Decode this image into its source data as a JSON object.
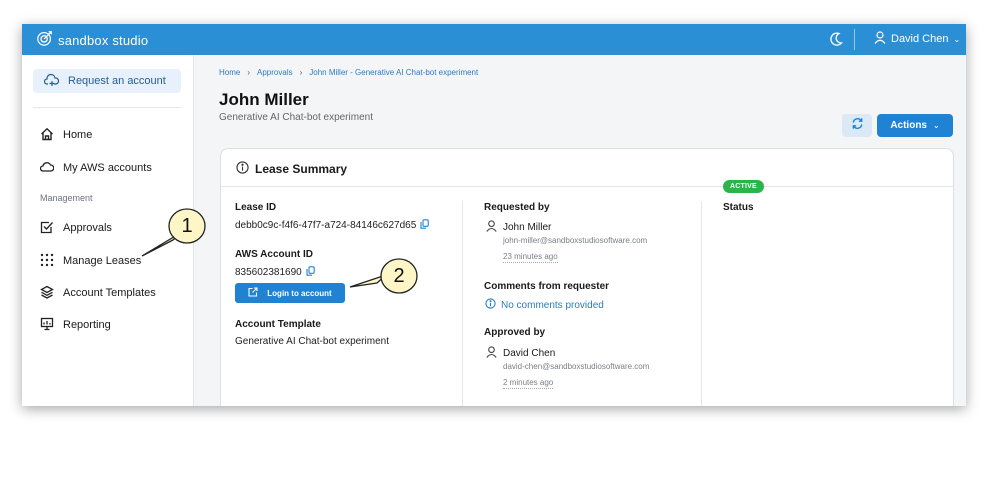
{
  "app": {
    "logo_text": "sandbox studio",
    "user_name": "David Chen",
    "accent_color": "#2b8fd6"
  },
  "sidebar": {
    "request_button": "Request an account",
    "items": [
      {
        "label": "Home",
        "icon": "home-icon"
      },
      {
        "label": "My AWS accounts",
        "icon": "cloud-icon"
      }
    ],
    "section_label": "Management",
    "management_items": [
      {
        "label": "Approvals",
        "icon": "checkbox-icon"
      },
      {
        "label": "Manage Leases",
        "icon": "grid-dots-icon"
      },
      {
        "label": "Account Templates",
        "icon": "layers-icon"
      },
      {
        "label": "Reporting",
        "icon": "presentation-chart-icon"
      }
    ]
  },
  "breadcrumb": [
    "Home",
    "Approvals",
    "John Miller - Generative AI Chat-bot experiment"
  ],
  "page": {
    "title": "John Miller",
    "subtitle": "Generative AI Chat-bot experiment",
    "actions_label": "Actions"
  },
  "lease_summary": {
    "title": "Lease Summary",
    "lease_id_label": "Lease ID",
    "lease_id": "debb0c9c-f4f6-47f7-a724-84146c627d65",
    "aws_account_label": "AWS Account ID",
    "aws_account_id": "835602381690",
    "login_button": "Login to account",
    "template_label": "Account Template",
    "template_value": "Generative AI Chat-bot experiment",
    "requested_by_label": "Requested by",
    "requester_name": "John Miller",
    "requester_email": "john-miller@sandboxstudiosoftware.com",
    "requested_time": "23 minutes ago",
    "comments_label": "Comments from requester",
    "comments_value": "No comments provided",
    "approved_by_label": "Approved by",
    "approver_name": "David Chen",
    "approver_email": "david-chen@sandboxstudiosoftware.com",
    "approved_time": "2 minutes ago",
    "status_label": "Status",
    "status_value": "ACTIVE",
    "status_color": "#2cb34a"
  },
  "callouts": [
    "1",
    "2"
  ]
}
